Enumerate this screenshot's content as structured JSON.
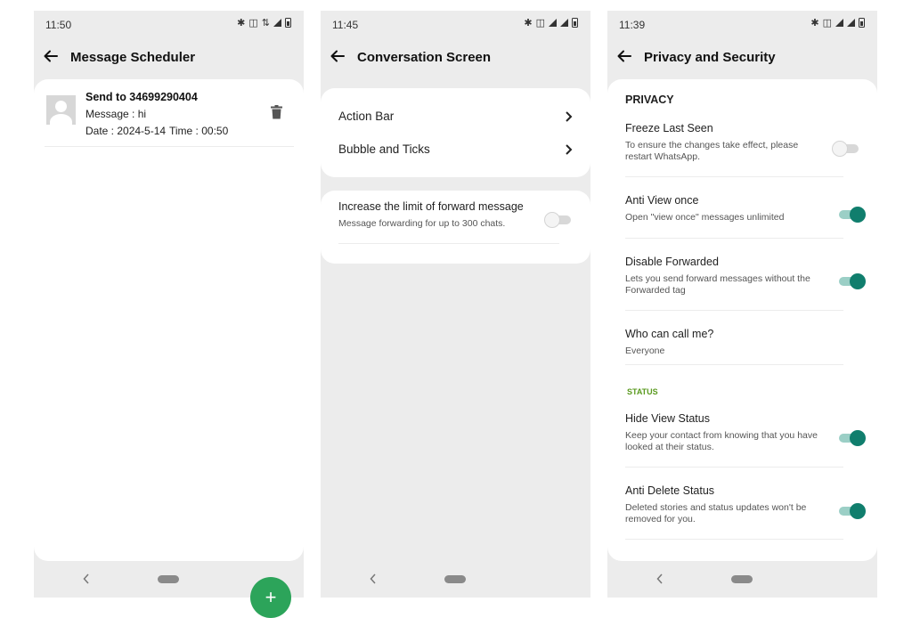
{
  "colors": {
    "accent": "#107e6d",
    "fab": "#2ca45a",
    "status_header": "#5a9a1f"
  },
  "panels": [
    {
      "status_time": "11:50",
      "title": "Message Scheduler",
      "item": {
        "recipient": "Send to 34699290404",
        "message": "Message : hi",
        "date": "Date : 2024-5-14",
        "time": "Time : 00:50"
      },
      "fab_icon": "+"
    },
    {
      "status_time": "11:45",
      "title": "Conversation Screen",
      "menu": [
        {
          "label": "Action Bar"
        },
        {
          "label": "Bubble and Ticks"
        }
      ],
      "forward": {
        "title": "Increase the limit of forward message",
        "subtitle": "Message forwarding for up to 300 chats.",
        "enabled": false
      }
    },
    {
      "status_time": "11:39",
      "title": "Privacy and Security",
      "privacy_header": "PRIVACY",
      "status_header": "STATUS",
      "settings": [
        {
          "title": "Freeze Last Seen",
          "subtitle": "To ensure the changes take effect, please restart WhatsApp.",
          "enabled": false
        },
        {
          "title": "Anti View once",
          "subtitle": "Open \"view once\" messages unlimited",
          "enabled": true
        },
        {
          "title": "Disable Forwarded",
          "subtitle": "Lets you send forward messages without the Forwarded tag",
          "enabled": true
        },
        {
          "title": "Who can call me?",
          "subtitle": "Everyone"
        },
        {
          "title": "Hide View Status",
          "subtitle": "Keep your contact from knowing that you have looked at their status.",
          "enabled": true
        },
        {
          "title": "Anti Delete Status",
          "subtitle": "Deleted stories and status updates won't be removed for you.",
          "enabled": true
        }
      ]
    }
  ]
}
